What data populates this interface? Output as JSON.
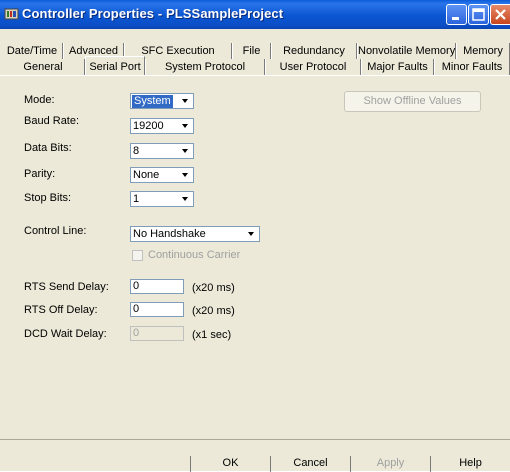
{
  "window": {
    "title": "Controller Properties - PLSSampleProject"
  },
  "tabs": {
    "row1": [
      "Date/Time",
      "Advanced",
      "SFC Execution",
      "File",
      "Redundancy",
      "Nonvolatile Memory",
      "Memory"
    ],
    "row2": [
      "General",
      "Serial Port",
      "System Protocol",
      "User Protocol",
      "Major Faults",
      "Minor Faults"
    ],
    "active": "Serial Port"
  },
  "form": {
    "mode": {
      "label": "Mode:",
      "value": "System"
    },
    "baud_rate": {
      "label": "Baud Rate:",
      "value": "19200"
    },
    "data_bits": {
      "label": "Data Bits:",
      "value": "8"
    },
    "parity": {
      "label": "Parity:",
      "value": "None"
    },
    "stop_bits": {
      "label": "Stop Bits:",
      "value": "1"
    },
    "control_line": {
      "label": "Control Line:",
      "value": "No Handshake"
    },
    "continuous_carrier": {
      "label": "Continuous Carrier",
      "checked": false,
      "enabled": false
    },
    "rts_send_delay": {
      "label": "RTS Send Delay:",
      "value": "0",
      "unit": "(x20 ms)"
    },
    "rts_off_delay": {
      "label": "RTS Off Delay:",
      "value": "0",
      "unit": "(x20 ms)"
    },
    "dcd_wait_delay": {
      "label": "DCD Wait Delay:",
      "value": "0",
      "unit": "(x1 sec)"
    },
    "show_offline_values": {
      "label": "Show Offline Values",
      "enabled": false
    }
  },
  "footer": {
    "ok": "OK",
    "cancel": "Cancel",
    "apply": "Apply",
    "help": "Help"
  },
  "colors": {
    "titlebar": "#0a56d2",
    "dialog_bg": "#ece9d8",
    "selection": "#316ac5",
    "close_button": "#c8451c"
  }
}
